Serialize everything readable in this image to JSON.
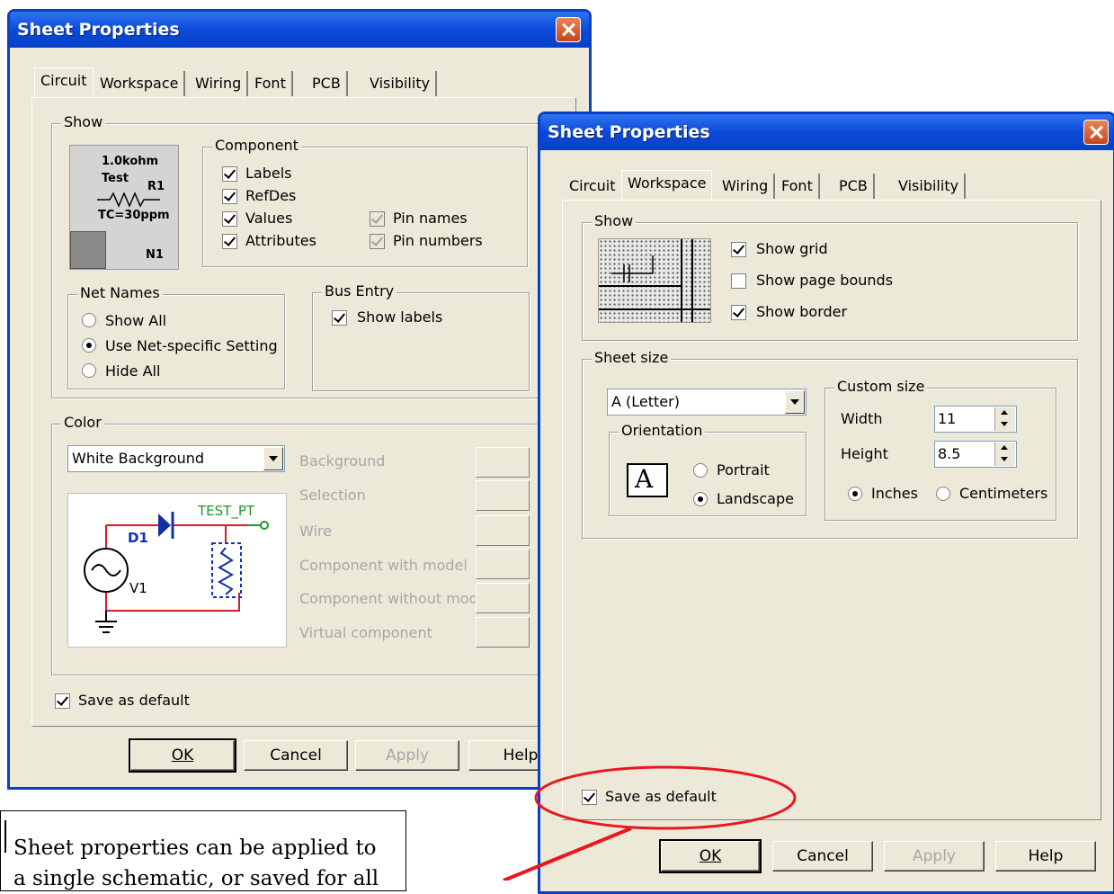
{
  "left_dialog": {
    "title": "Sheet Properties",
    "tabs": [
      "Circuit",
      "Workspace",
      "Wiring",
      "Font",
      "PCB",
      "Visibility"
    ],
    "active_tab": "Circuit",
    "show_group": "Show",
    "preview": {
      "line1": "1.0kohm",
      "line2": "Test",
      "ref": "R1",
      "line3": "TC=30ppm",
      "net": "N1"
    },
    "component": {
      "title": "Component",
      "labels": "Labels",
      "refdes": "RefDes",
      "values": "Values",
      "attributes": "Attributes",
      "pin_names": "Pin names",
      "pin_numbers": "Pin numbers"
    },
    "net_names": {
      "title": "Net Names",
      "show_all": "Show All",
      "use_net_specific": "Use Net-specific Setting",
      "hide_all": "Hide All"
    },
    "bus_entry": {
      "title": "Bus Entry",
      "show_labels": "Show labels"
    },
    "color": {
      "title": "Color",
      "scheme": "White Background",
      "background": "Background",
      "selection": "Selection",
      "wire": "Wire",
      "component_with_model": "Component with model",
      "component_without_model": "Component without model",
      "virtual_component": "Virtual component"
    },
    "circuit_preview": {
      "test_pt": "TEST_PT",
      "d1": "D1",
      "v1": "V1"
    },
    "save_default": "Save as default",
    "buttons": {
      "ok": "OK",
      "cancel": "Cancel",
      "apply": "Apply",
      "help": "Help"
    }
  },
  "right_dialog": {
    "title": "Sheet Properties",
    "tabs": [
      "Circuit",
      "Workspace",
      "Wiring",
      "Font",
      "PCB",
      "Visibility"
    ],
    "active_tab": "Workspace",
    "show_group": "Show",
    "show_grid": "Show grid",
    "show_page_bounds": "Show page bounds",
    "show_border": "Show border",
    "sheet_size": {
      "title": "Sheet size",
      "selected": "A (Letter)",
      "orientation": "Orientation",
      "portrait": "Portrait",
      "landscape": "Landscape",
      "icon_letter": "A"
    },
    "custom_size": {
      "title": "Custom size",
      "width_label": "Width",
      "width_value": "11",
      "height_label": "Height",
      "height_value": "8.5",
      "inches": "Inches",
      "centimeters": "Centimeters"
    },
    "save_default": "Save as default",
    "buttons": {
      "ok": "OK",
      "cancel": "Cancel",
      "apply": "Apply",
      "help": "Help"
    }
  },
  "annotation": {
    "text_line1": "Sheet properties can be applied to",
    "text_line2": "a single schematic, or saved for all",
    "highlight_color": "#e8181e"
  }
}
